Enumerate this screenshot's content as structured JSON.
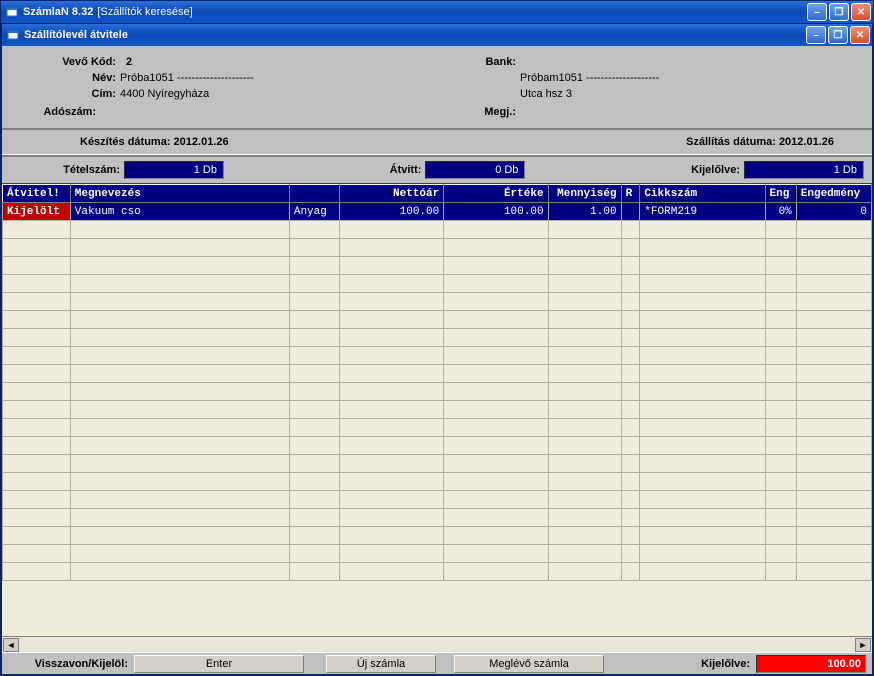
{
  "outer": {
    "title": "SzámlaN 8.32",
    "subtitle": "[Szállítók keresése]"
  },
  "inner": {
    "title": "Szállítólevél átvitele"
  },
  "header": {
    "vevokod_label": "Vevő Kód:",
    "vevokod": "2",
    "nev_label": "Név:",
    "nev": "Próba1051 ---------------------",
    "cim_label": "Cím:",
    "cim": "4400 Nyíregyháza",
    "adoszam_label": "Adószám:",
    "adoszam": "",
    "bank_label": "Bank:",
    "bank_nev": "Próbam1051 --------------------",
    "bank_utca": "Utca hsz 3",
    "megj_label": "Megj.:",
    "megj": ""
  },
  "dates": {
    "keszites_label": "Készítés dátuma:",
    "keszites": "2012.01.26",
    "szallitas_label": "Szállítás dátuma:",
    "szallitas": "2012.01.26"
  },
  "counts": {
    "tetelszam_label": "Tételszám:",
    "tetelszam": "1 Db",
    "atvitt_label": "Átvitt:",
    "atvitt": "0 Db",
    "kijelolve_label": "Kijelőlve:",
    "kijelolve": "1 Db"
  },
  "grid": {
    "headers": {
      "atvitel": "Átvitel!",
      "megnevezes": "Megnevezés",
      "tipuscol": "",
      "nettoar": "Nettóár",
      "erteke": "Értéke",
      "mennyiseg": "Mennyiség",
      "r": "R",
      "cikkszam": "Cikkszám",
      "eng": "Eng",
      "engedmeny": "Engedmény"
    },
    "rows": [
      {
        "marker": "Kijelölt",
        "megnevezes": "Vakuum cso",
        "tipus": "Anyag",
        "nettoar": "100.00",
        "erteke": "100.00",
        "mennyiseg": "1.00",
        "r": "",
        "cikkszam": "*FORM219",
        "eng": "0%",
        "engedmeny": "0"
      }
    ],
    "empty_rows": 20
  },
  "footer": {
    "visszavon_label": "Visszavon/Kijelöl:",
    "btn_enter": "Enter",
    "btn_uj": "Új számla",
    "btn_meglevo": "Meglévő számla",
    "kijelolve_label": "Kijelőlve:",
    "total": "100.00"
  },
  "icons": {
    "minimize": "–",
    "maximize": "❐",
    "restore": "❐",
    "close": "✕",
    "left_arrow": "◄",
    "right_arrow": "►"
  }
}
